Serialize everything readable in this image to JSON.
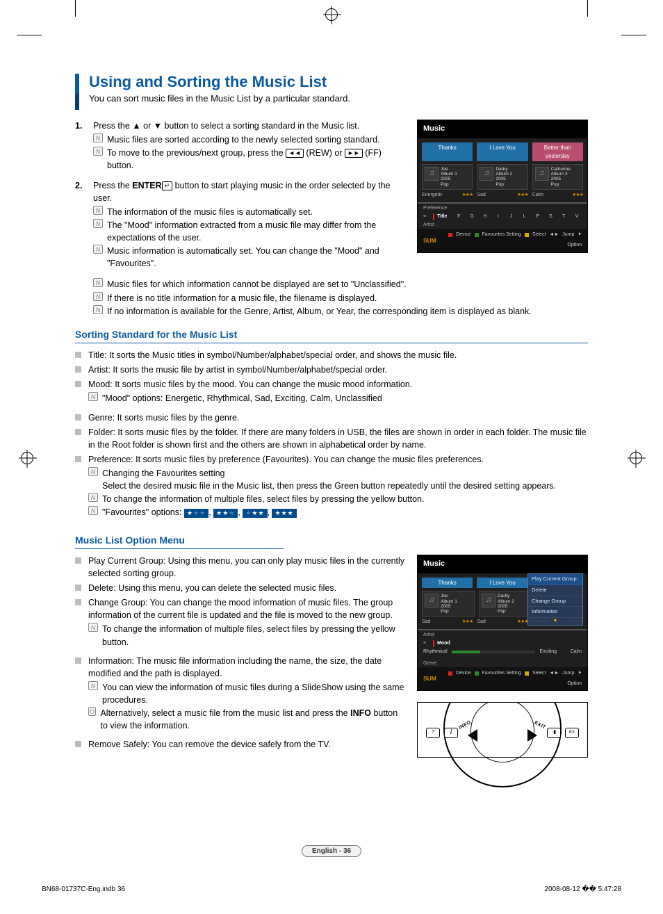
{
  "title": "Using and Sorting the Music List",
  "intro": "You can sort music files in the Music List by a particular standard.",
  "steps": {
    "s1": {
      "num": "1.",
      "text": "Press the ▲ or ▼ button to select a sorting standard in the Music list.",
      "notes": [
        "Music files are sorted according to the newly selected sorting standard.",
        {
          "pre": "To move to the previous/next group, press the ",
          "k1": "◄◄",
          "mid1": " (REW) or ",
          "k2": "►►",
          "post": " (FF) button."
        }
      ]
    },
    "s2": {
      "num": "2.",
      "pre": "Press the ",
      "bold": "ENTER",
      "post": " button to start playing music in the order selected by the user.",
      "notes": [
        "The information of the music files is automatically set.",
        "The \"Mood\" information extracted from a music file may differ from the expectations of the user.",
        "Music information is automatically set. You can change the \"Mood\" and \"Favourites\".",
        "Music files for which information cannot be displayed are set to \"Unclassified\".",
        "If there is no title information for a music file, the filename is displayed.",
        "If no information is available for the Genre, Artist, Album, or Year, the corresponding item is displayed as blank."
      ]
    }
  },
  "section2_title": "Sorting Standard for the Music List",
  "sorting": {
    "title_desc": "Title: It sorts the Music titles in symbol/Number/alphabet/special order, and shows the music file.",
    "artist_desc": "Artist: It sorts the music file by artist in symbol/Number/alphabet/special order.",
    "mood_desc": "Mood: It sorts music files by the mood. You can change the music mood information.",
    "mood_note": "\"Mood\" options: Energetic, Rhythmical, Sad, Exciting, Calm, Unclassified",
    "genre_desc": "Genre: It sorts music files by the genre.",
    "folder_desc": "Folder: It sorts music files by the folder. If there are many folders in USB, the files are shown in order in each folder. The music file in the Root folder is shown first and the others are shown in alphabetical order by name.",
    "pref_desc": "Preference: It sorts music files by preference (Favourites). You can change the music files preferences.",
    "pref_note1": "Changing the Favourites setting",
    "pref_note1b": "Select the desired music file in the Music list, then press the Green button repeatedly until the desired setting appears.",
    "pref_note2": "To change the information of multiple files, select files by pressing the yellow button.",
    "pref_note3_label": "\"Favourites\" options: "
  },
  "section3_title": "Music List Option Menu",
  "options": {
    "o1": "Play Current Group: Using this menu, you can only play music files in the currently selected sorting group.",
    "o2": "Delete: Using this menu, you can delete the selected music files.",
    "o3": "Change Group: You can change the mood information of music files. The group information of the current file is updated and the file is moved to the new group.",
    "o3_note": "To change the information of multiple files, select files by pressing the yellow button.",
    "o4": "Information: The music file information including the name, the size, the date modified and the path is displayed.",
    "o4_note1": "You can view the information of music files during a SlideShow using the same procedures.",
    "o4_note2_pre": "Alternatively, select a music file from the music list and press the ",
    "o4_note2_bold": "INFO",
    "o4_note2_post": " button to view the information.",
    "o5": "Remove Safely: You can remove the device safely from the TV."
  },
  "osd1": {
    "title": "Music",
    "tabs": [
      "Thanks",
      "I Love You",
      "Better than yesterday"
    ],
    "cards": [
      {
        "name": "Joe",
        "l1": "Album 1",
        "l2": "2005",
        "l3": "Pop"
      },
      {
        "name": "Darby",
        "l1": "Album 2",
        "l2": "2005",
        "l3": "Pop"
      },
      {
        "name": "Catherine",
        "l1": "Album 3",
        "l2": "2005",
        "l3": "Pop"
      }
    ],
    "moods": [
      "Energetic",
      "Sad",
      "Calm"
    ],
    "cats": {
      "pref": "Preference",
      "title": "Title",
      "artist": "Artist"
    },
    "alpha": [
      "F",
      "G",
      "H",
      "I",
      "J",
      "L",
      "P",
      "S",
      "T",
      "V"
    ],
    "sum": "SUM",
    "legend": {
      "dev": "Device",
      "fav": "Favourites Setting",
      "sel": "Select",
      "jump": "Jump",
      "opt": "Option"
    }
  },
  "osd2": {
    "title": "Music",
    "tabs": [
      "Thanks",
      "I Love You"
    ],
    "menu": [
      "Play Current Group",
      "Delete",
      "Change Group",
      "Information"
    ],
    "cards": [
      {
        "name": "Joe",
        "l1": "Album 1",
        "l2": "2005",
        "l3": "Pop"
      },
      {
        "name": "Darby",
        "l1": "Album 2",
        "l2": "2005",
        "l3": "Pop"
      }
    ],
    "moods_top": [
      "Sad",
      "Sad"
    ],
    "mood_right": "Exciting",
    "cats": {
      "artist": "Artist",
      "mood": "Mood",
      "genre": "Genre"
    },
    "slider": {
      "left": "Rhythmical",
      "mid": "Exciting",
      "right": "Calm"
    },
    "sum": "SUM",
    "legend": {
      "dev": "Device",
      "fav": "Favourites Setting",
      "sel": "Select",
      "jump": "Jump",
      "opt": "Option"
    }
  },
  "remote": {
    "info": "INFO",
    "exit": "EXIT",
    "q": "?",
    "i": "i",
    "x": "·▮",
    "ex": "EX"
  },
  "pagenum": "English - 36",
  "footer": {
    "left": "BN68-01737C-Eng.indb   36",
    "right": "2008-08-12   �� 5:47:28"
  }
}
